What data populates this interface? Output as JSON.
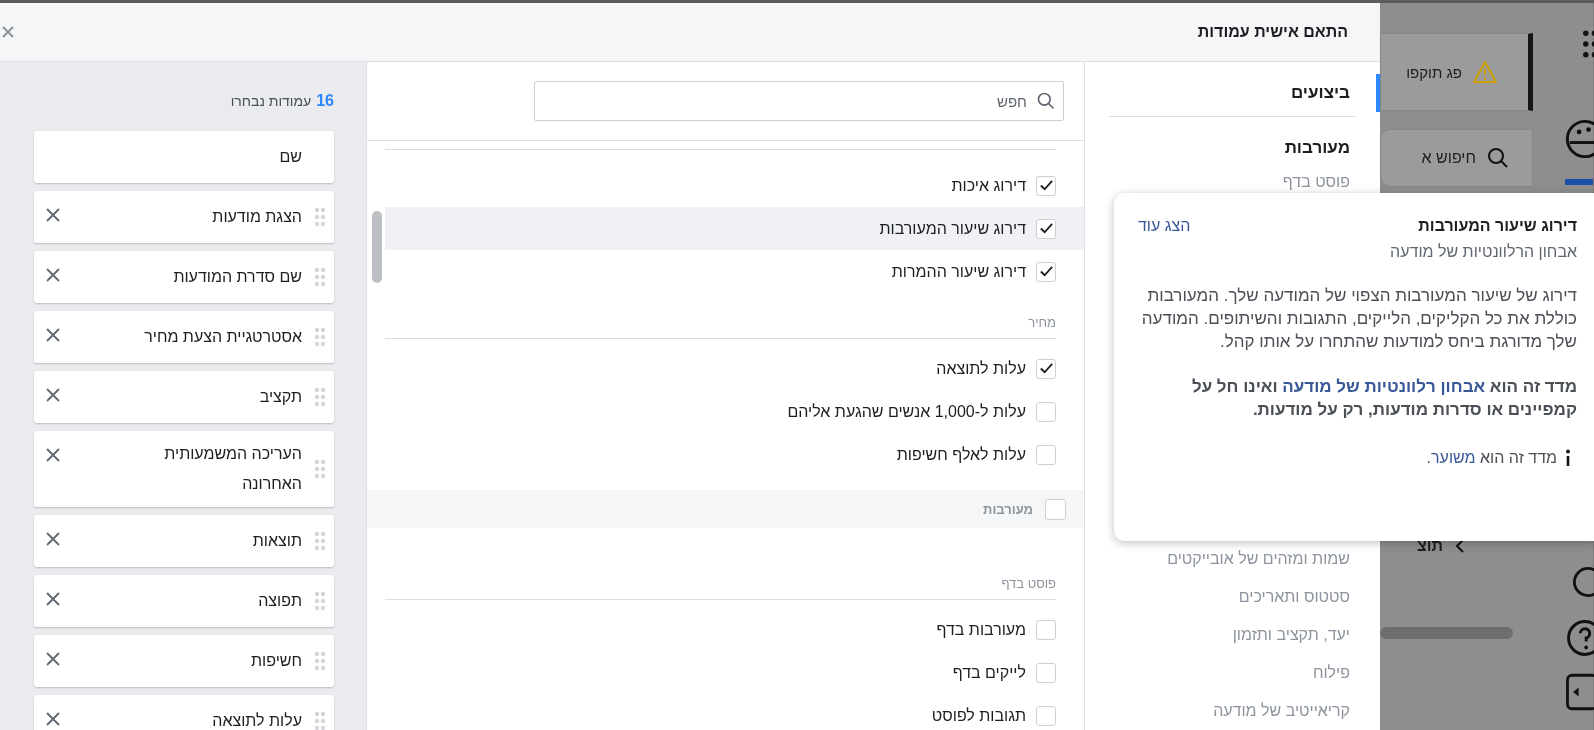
{
  "background": {
    "alert": "פג תוקפו",
    "search_placeholder": "חיפוש א",
    "section": "תוצ"
  },
  "dialog": {
    "title": "התאם אישית עמודות"
  },
  "nav": {
    "top": [
      {
        "label": "ביצועים",
        "kind": "heading",
        "selected": true
      },
      {
        "label": "מעורבות",
        "kind": "heading",
        "selected": false
      },
      {
        "label": "פוסט בדף",
        "kind": "item",
        "selected": false
      }
    ],
    "bottom": [
      {
        "label": "שמות ומזהים של אובייקטים",
        "kind": "item",
        "selected": false
      },
      {
        "label": "סטטוס ותאריכים",
        "kind": "item",
        "selected": false
      },
      {
        "label": "יעד, תקציב ותזמון",
        "kind": "item",
        "selected": false
      },
      {
        "label": "פילוח",
        "kind": "item",
        "selected": false
      },
      {
        "label": "קריאייטיב של מודעה",
        "kind": "item",
        "selected": false
      }
    ]
  },
  "search": {
    "placeholder": "חפש"
  },
  "metrics": [
    {
      "kind": "option",
      "label": "דירוג איכות",
      "checked": true,
      "highlighted": false
    },
    {
      "kind": "option",
      "label": "דירוג שיעור המעורבות",
      "checked": true,
      "highlighted": true
    },
    {
      "kind": "option",
      "label": "דירוג שיעור ההמרות",
      "checked": true,
      "highlighted": false
    },
    {
      "kind": "section",
      "label": "מחיר"
    },
    {
      "kind": "option",
      "label": "עלות לתוצאה",
      "checked": true,
      "highlighted": false
    },
    {
      "kind": "option",
      "label": "עלות ל-1,000 אנשים שהגעת אליהם",
      "checked": false,
      "highlighted": false
    },
    {
      "kind": "option",
      "label": "עלות לאלף חשיפות",
      "checked": false,
      "highlighted": false
    },
    {
      "kind": "group",
      "label": "מעורבות",
      "checked": false
    },
    {
      "kind": "section",
      "label": "פוסט בדף"
    },
    {
      "kind": "option",
      "label": "מעורבות בדף",
      "checked": false,
      "highlighted": false
    },
    {
      "kind": "option",
      "label": "לייקים בדף",
      "checked": false,
      "highlighted": false
    },
    {
      "kind": "option",
      "label": "תגובות לפוסט",
      "checked": false,
      "highlighted": false
    }
  ],
  "selected_columns": {
    "count": "16",
    "label": "עמודות נבחרו",
    "columns": [
      {
        "label": "שם",
        "kind": "fixed"
      },
      {
        "label": "הצגת מודעות",
        "kind": "removable"
      },
      {
        "label": "שם סדרת המודעות",
        "kind": "removable"
      },
      {
        "label": "אסטרטגיית הצעת מחיר",
        "kind": "removable"
      },
      {
        "label": "תקציב",
        "kind": "removable"
      },
      {
        "label": "העריכה המשמעותית האחרונה",
        "kind": "removable"
      },
      {
        "label": "תוצאות",
        "kind": "removable"
      },
      {
        "label": "תפוצה",
        "kind": "removable"
      },
      {
        "label": "חשיפות",
        "kind": "removable"
      },
      {
        "label": "עלות לתוצאה",
        "kind": "removable"
      }
    ]
  },
  "popover": {
    "title": "דירוג שיעור המעורבות",
    "more_link": "הצג עוד",
    "subtitle": "אבחון הרלוונטיות של מודעה",
    "description": "דירוג של שיעור המעורבות הצפוי של המודעה שלך. המעורבות כוללת את כל הקליקים, הלייקים, התגובות והשיתופים. המודעה שלך מדורגת ביחס למודעות שהתחרו על אותו קהל.",
    "note_before": "מדד זה הוא",
    "note_link": "אבחון רלוונטיות של מודעה",
    "note_after": "ואינו חל על קמפיינים או סדרות מודעות, רק על מודעות.",
    "info_before": "מדד זה הוא",
    "info_link": "משוער",
    "info_after": "."
  }
}
